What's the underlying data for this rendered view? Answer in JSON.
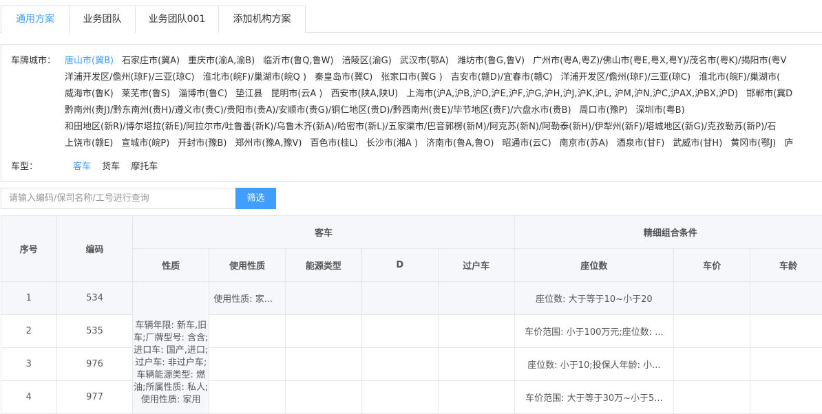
{
  "tabs": [
    "通用方案",
    "业务团队",
    "业务团队001",
    "添加机构方案"
  ],
  "filter": {
    "city_label": "车牌城市：",
    "city_lines": [
      [
        "唐山市(冀B)",
        "石家庄市(冀A)",
        "重庆市(渝A,渝B)",
        "临沂市(鲁Q,鲁W)",
        "涪陵区(渝G)",
        "武汉市(鄂A)",
        "潍坊市(鲁G,鲁V)",
        "广州市(粤A,粤Z)/佛山市(粤E,粤X,粤Y)/茂名市(粤K)/揭阳市(粤V"
      ],
      [
        "洋浦开发区/儋州(琼F)/三亚(琼C)",
        "淮北市(皖F)/巢湖市(皖Q )",
        "秦皇岛市(冀C)",
        "张家口市(冀G )",
        "吉安市(赣D)/宜春市(赣C)",
        "洋浦开发区/儋州(琼F)/三亚(琼C)",
        "淮北市(皖F)/巢湖市("
      ],
      [
        "威海市(鲁K)",
        "莱芜市(鲁S)",
        "淄博市(鲁C)",
        "垫江县",
        "昆明市(云A )",
        "西安市(陕A,陕U)",
        "上海市(沪A,沪B,沪D,沪E,沪F,沪G,沪H,沪J,沪K,沪L, 沪M,沪N,沪C,沪AX,沪BX,沪D)",
        "邯郸市(冀D"
      ],
      [
        "黔南州(贵J)/黔东南州(贵H)/遵义市(贵C)/贵阳市(贵A)/安顺市(贵G)/铜仁地区(贵D)/黔西南州(贵E)/毕节地区(贵F)/六盘水市(贵B)",
        "周口市(豫P)",
        "深圳市(粤B)"
      ],
      [
        "和田地区(新R)/博尔塔拉(新E)/阿拉尔市/吐鲁番(新K)/乌鲁木齐(新A)/哈密市(新L)/五家渠市/巴音郭楞(新M)/阿克苏(新N)/阿勒泰(新H)/伊犁州(新F)/塔城地区(新G)/克孜勒苏(新P)/石"
      ],
      [
        "上饶市(赣E)",
        "宣城市(皖P)",
        "开封市(豫B)",
        "郑州市(豫A,豫V)",
        "百色市(桂L)",
        "长沙市(湘A )",
        "济南市(鲁A,鲁O)",
        "昭通市(云C)",
        "南京市(苏A)",
        "酒泉市(甘F)",
        "武威市(甘H)",
        "黄冈市(鄂J)",
        "庐"
      ]
    ],
    "type_label": "车型：",
    "vehicle_types": [
      "客车",
      "货车",
      "摩托车"
    ],
    "selected_type": "客车"
  },
  "search": {
    "placeholder": "请输入编码/保司名称/工号进行查询",
    "button": "筛选"
  },
  "table": {
    "group_headers": {
      "seq": "序号",
      "code": "编码",
      "passenger": "客车",
      "combo": "精细组合条件"
    },
    "sub_headers": [
      "性质",
      "使用性质",
      "能源类型",
      "D",
      "过户车",
      "座位数",
      "车价",
      "车龄"
    ],
    "merged_nature": "车辆年限: 新车,旧车;厂牌型号: 含含;进口车: 国产,进口;过户车: 非过户车;车辆能源类型: 燃油;所属性质: 私人;使用性质: 家用",
    "rows": [
      {
        "seq": "1",
        "code": "534",
        "usage": "使用性质: 家...",
        "seats": "座位数: 大于等于10~小于20"
      },
      {
        "seq": "2",
        "code": "535",
        "usage": "",
        "seats": "车价范围: 小于100万元;座位数: ..."
      },
      {
        "seq": "3",
        "code": "976",
        "usage": "",
        "seats": "座位数: 小于10;投保人年龄: 小..."
      },
      {
        "seq": "4",
        "code": "977",
        "usage": "",
        "seats": "车价范围: 大于等于30万~小于5..."
      }
    ]
  }
}
